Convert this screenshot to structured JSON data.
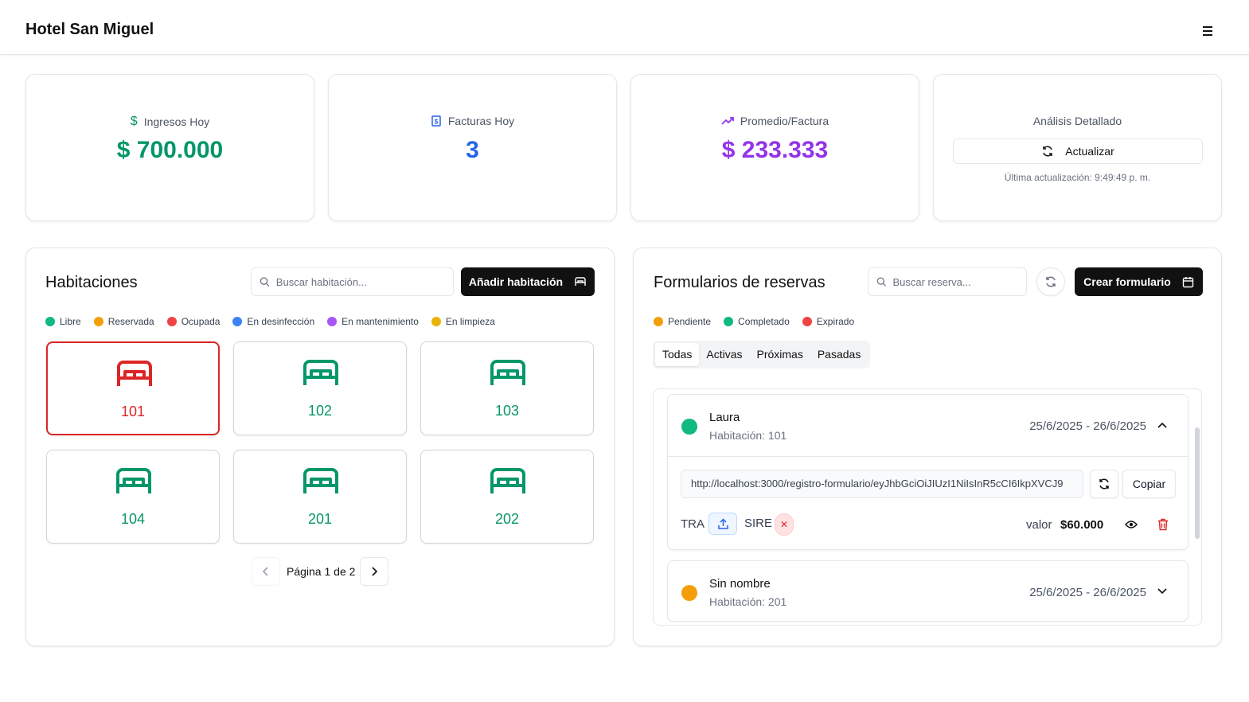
{
  "app": {
    "title": "Hotel San Miguel"
  },
  "stats": {
    "income": {
      "label": "Ingresos Hoy",
      "value": "$ 700.000",
      "color": "#059669"
    },
    "invoices": {
      "label": "Facturas Hoy",
      "value": "3",
      "color": "#2563eb"
    },
    "average": {
      "label": "Promedio/Factura",
      "value": "$ 233.333",
      "color": "#9333ea"
    },
    "analysis": {
      "label": "Análisis Detallado",
      "refresh_label": "Actualizar",
      "last_update": "Última actualización: 9:49:49 p. m."
    }
  },
  "rooms_panel": {
    "title": "Habitaciones",
    "search_placeholder": "Buscar habitación...",
    "add_label": "Añadir habitación",
    "legend": [
      {
        "label": "Libre",
        "color": "#10b981"
      },
      {
        "label": "Reservada",
        "color": "#f59e0b"
      },
      {
        "label": "Ocupada",
        "color": "#ef4444"
      },
      {
        "label": "En desinfección",
        "color": "#3b82f6"
      },
      {
        "label": "En mantenimiento",
        "color": "#a855f7"
      },
      {
        "label": "En limpieza",
        "color": "#eab308"
      }
    ],
    "rooms": [
      {
        "number": "101",
        "status": "Ocupada",
        "color": "#dc2626"
      },
      {
        "number": "102",
        "status": "Libre",
        "color": "#059669"
      },
      {
        "number": "103",
        "status": "Libre",
        "color": "#059669"
      },
      {
        "number": "104",
        "status": "Libre",
        "color": "#059669"
      },
      {
        "number": "201",
        "status": "Libre",
        "color": "#059669"
      },
      {
        "number": "202",
        "status": "Libre",
        "color": "#059669"
      }
    ],
    "pagination": "Página 1 de 2"
  },
  "reservations_panel": {
    "title": "Formularios de reservas",
    "search_placeholder": "Buscar reserva...",
    "create_label": "Crear formulario",
    "legend": [
      {
        "label": "Pendiente",
        "color": "#f59e0b"
      },
      {
        "label": "Completado",
        "color": "#10b981"
      },
      {
        "label": "Expirado",
        "color": "#ef4444"
      }
    ],
    "tabs": [
      "Todas",
      "Activas",
      "Próximas",
      "Pasadas"
    ],
    "items": [
      {
        "name": "Laura",
        "room": "Habitación: 101",
        "dates": "25/6/2025 - 26/6/2025",
        "status_color": "#10b981",
        "url": "http://localhost:3000/registro-formulario/eyJhbGciOiJIUzI1NiIsInR5cCI6IkpXVCJ9",
        "copy_label": "Copiar",
        "tra_label": "TRA",
        "sire_label": "SIRE",
        "value_label": "valor",
        "value": "$60.000"
      },
      {
        "name": "Sin nombre",
        "room": "Habitación: 201",
        "dates": "25/6/2025 - 26/6/2025",
        "status_color": "#f59e0b"
      }
    ]
  }
}
